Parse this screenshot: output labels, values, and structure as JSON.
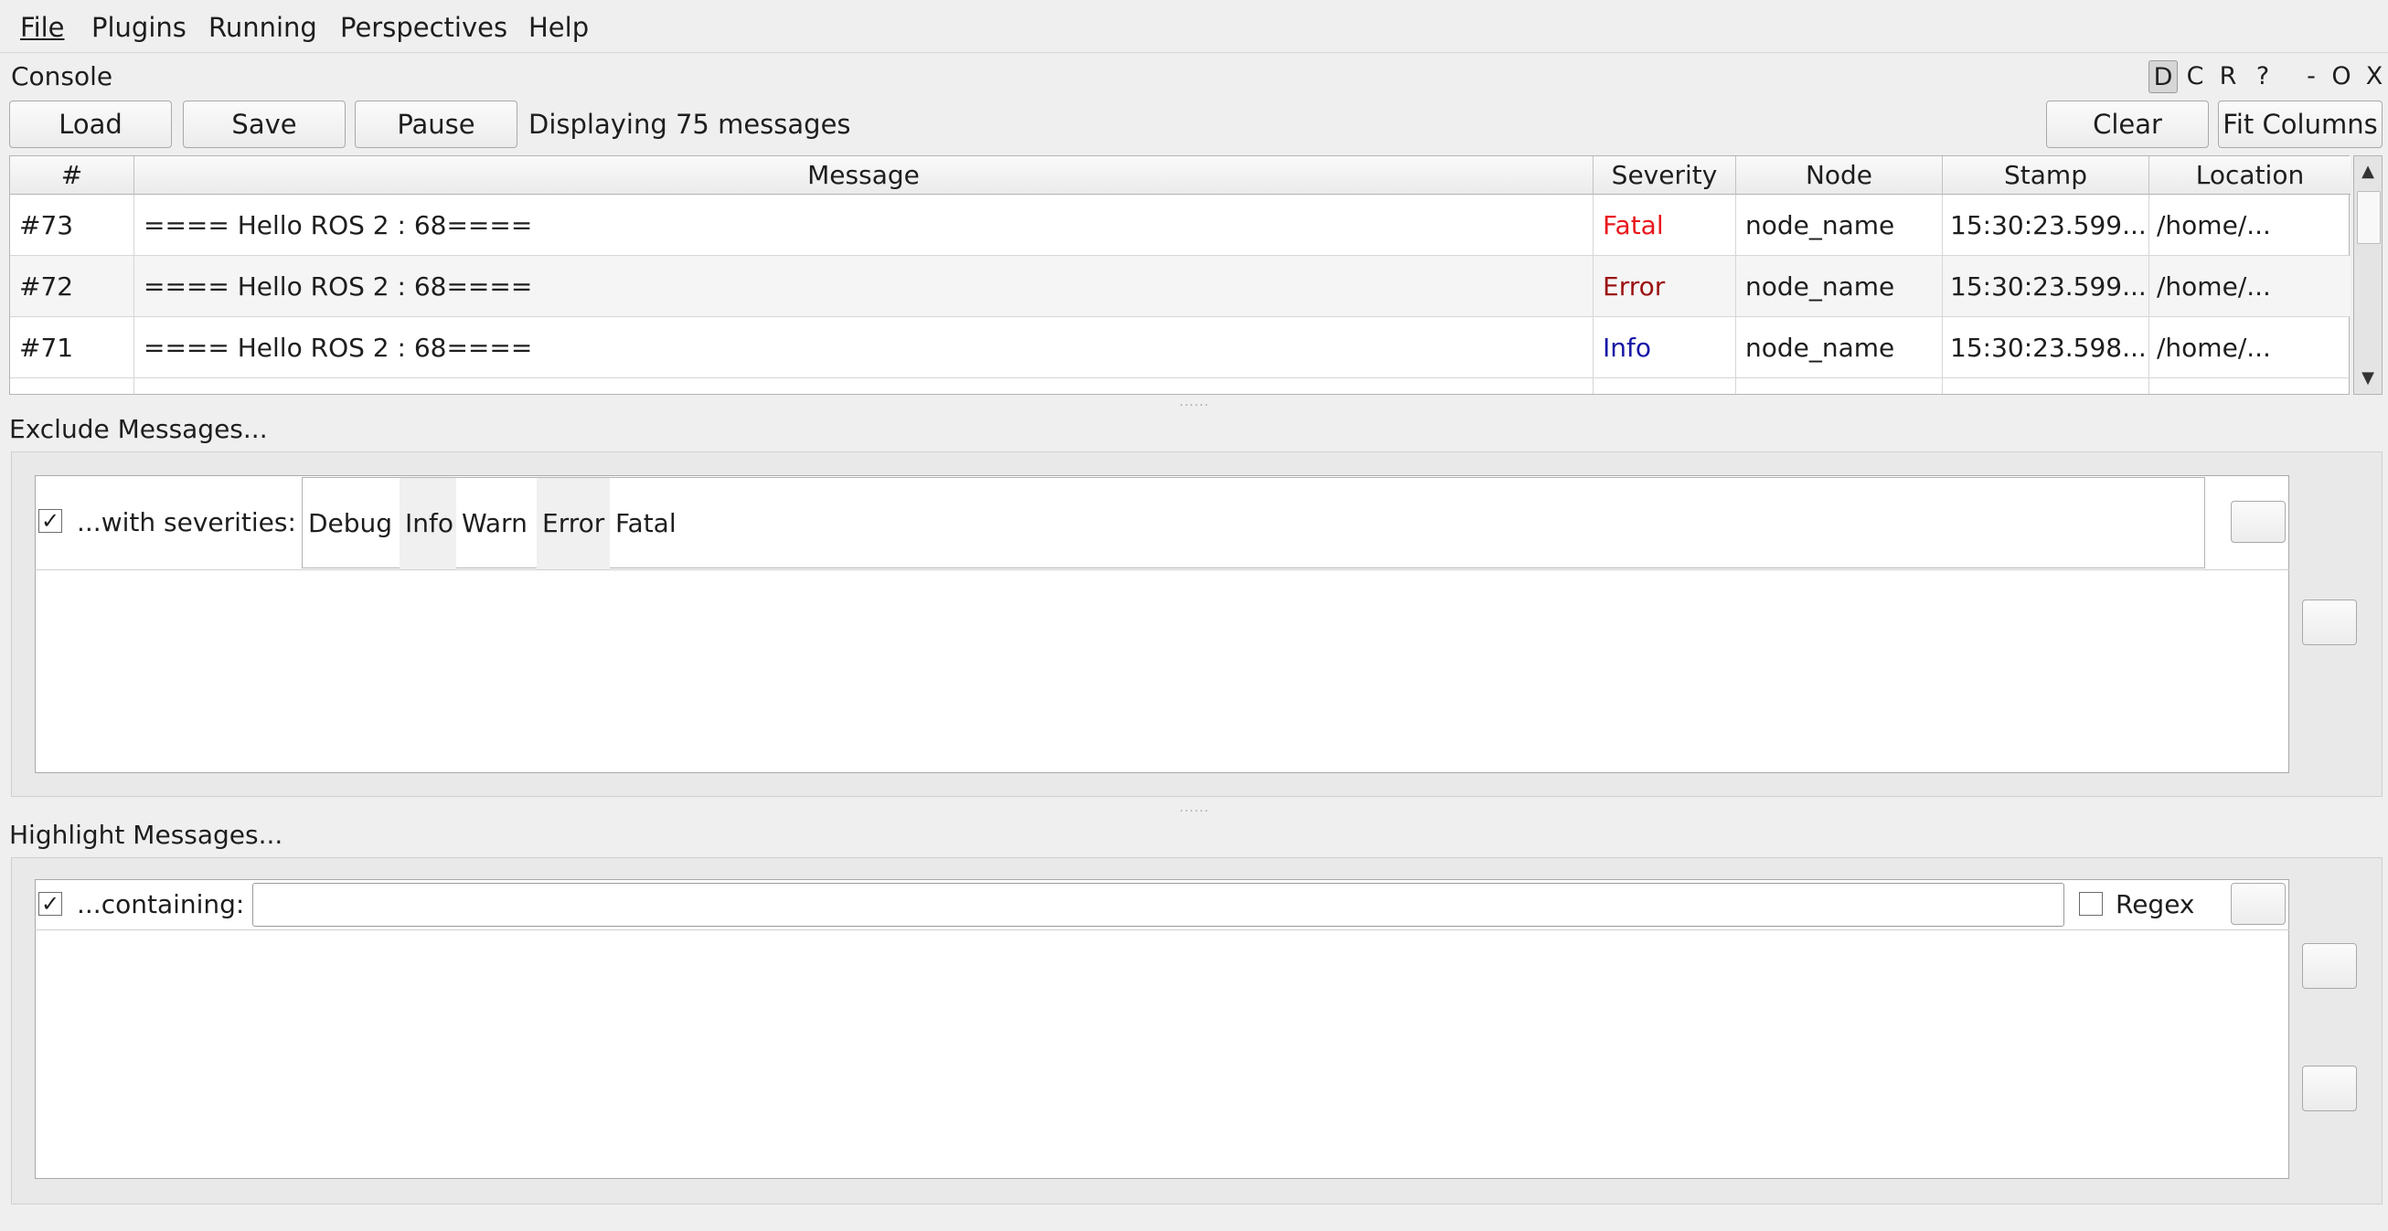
{
  "menu": {
    "file": "File",
    "plugins": "Plugins",
    "running": "Running",
    "perspectives": "Perspectives",
    "help": "Help"
  },
  "console": {
    "title": "Console",
    "title_controls": [
      "D",
      "C",
      "R",
      "?",
      "-",
      "O",
      "X"
    ]
  },
  "toolbar": {
    "load": "Load",
    "save": "Save",
    "pause": "Pause",
    "status": "Displaying 75 messages",
    "clear": "Clear",
    "fit_columns": "Fit Columns"
  },
  "table": {
    "columns": [
      "#",
      "Message",
      "Severity",
      "Node",
      "Stamp",
      "Location"
    ],
    "rows": [
      {
        "num": "#73",
        "message": "==== Hello ROS 2 : 68====",
        "severity": "Fatal",
        "node": "node_name",
        "stamp": "15:30:23.599...",
        "location": "/home/..."
      },
      {
        "num": "#72",
        "message": "==== Hello ROS 2 : 68====",
        "severity": "Error",
        "node": "node_name",
        "stamp": "15:30:23.599...",
        "location": "/home/..."
      },
      {
        "num": "#71",
        "message": "==== Hello ROS 2 : 68====",
        "severity": "Info",
        "node": "node_name",
        "stamp": "15:30:23.598...",
        "location": "/home/..."
      }
    ],
    "severity_colors": {
      "Fatal": "#e8171c",
      "Error": "#9b1111",
      "Info": "#1515a6"
    }
  },
  "exclude": {
    "title": "Exclude Messages...",
    "filter_label": "...with severities:",
    "checked": true,
    "severities": [
      "Debug",
      "Info",
      "Warn",
      "Error",
      "Fatal"
    ]
  },
  "highlight": {
    "title": "Highlight Messages...",
    "filter_label": "...containing:",
    "checked": true,
    "input_value": "",
    "regex_label": "Regex",
    "regex_checked": false
  },
  "icons": {
    "checkmark": "✓",
    "scroll_up": "▲",
    "scroll_down": "▼",
    "splitter": "......"
  }
}
